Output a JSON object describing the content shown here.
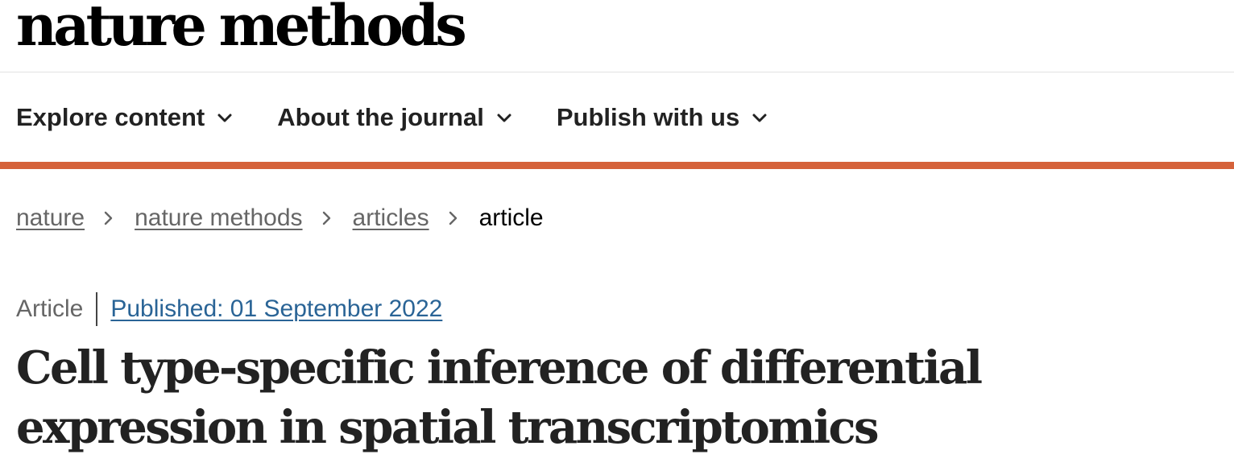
{
  "header": {
    "logo_text": "nature methods"
  },
  "nav": {
    "items": [
      {
        "label": "Explore content",
        "icon": "chevron-down-icon"
      },
      {
        "label": "About the journal",
        "icon": "chevron-down-icon"
      },
      {
        "label": "Publish with us",
        "icon": "chevron-down-icon"
      }
    ],
    "accent_color": "#d5623a"
  },
  "breadcrumb": {
    "items": [
      {
        "label": "nature"
      },
      {
        "label": "nature methods"
      },
      {
        "label": "articles"
      },
      {
        "label": "article"
      }
    ],
    "separator_icon": "chevron-right-icon"
  },
  "article": {
    "type": "Article",
    "published": "Published: 01 September 2022",
    "title": "Cell type-specific inference of differential expression in spatial transcriptomics",
    "link_color": "#2a6496"
  }
}
